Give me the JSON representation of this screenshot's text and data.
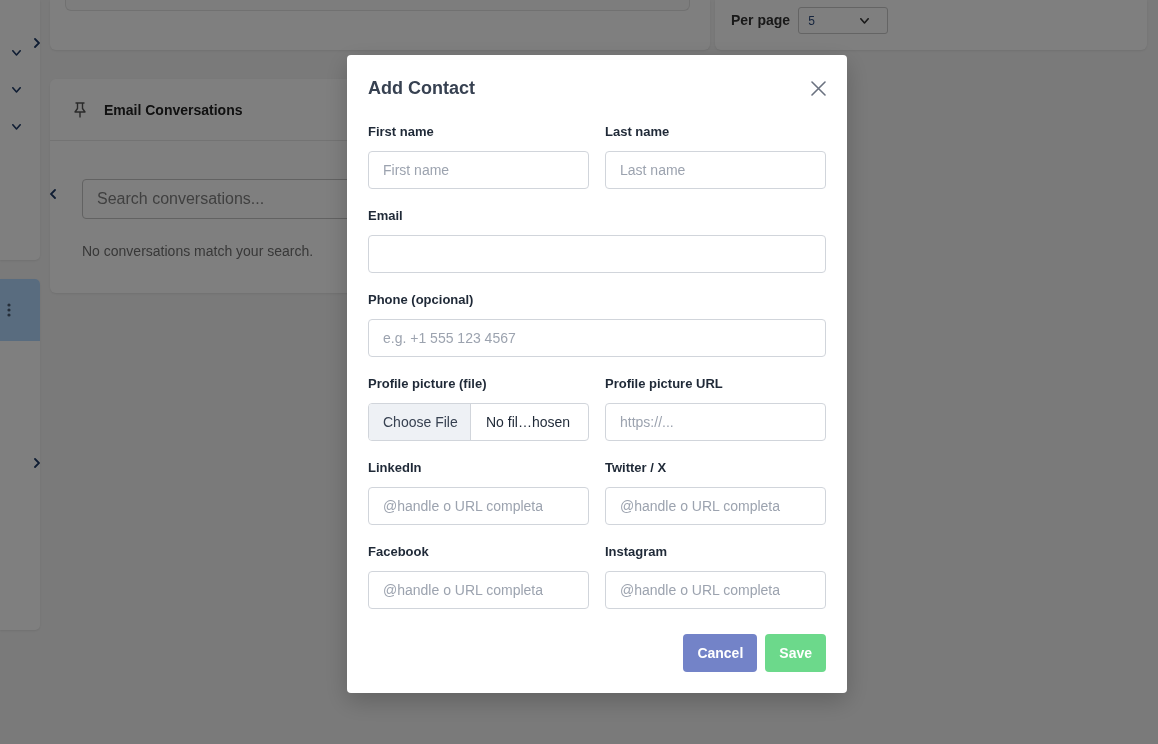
{
  "pagination": {
    "label": "Per page",
    "value": "5"
  },
  "conversations": {
    "title": "Email Conversations",
    "search": {
      "placeholder": "Search conversations..."
    },
    "empty_message": "No conversations match your search."
  },
  "dialog": {
    "title": "Add Contact",
    "rows": [
      [
        {
          "kind": "text",
          "label": "First name",
          "placeholder": "First name"
        },
        {
          "kind": "text",
          "label": "Last name",
          "placeholder": "Last name"
        }
      ],
      [
        {
          "kind": "text",
          "label": "Email"
        }
      ],
      [
        {
          "kind": "text",
          "label": "Phone (opcional)",
          "placeholder": "e.g. +1 555 123 4567"
        }
      ],
      [
        {
          "kind": "file",
          "label": "Profile picture (file)",
          "button": "Choose File",
          "status": "No fil…hosen"
        },
        {
          "kind": "text",
          "label": "Profile picture URL",
          "placeholder": "https://..."
        }
      ],
      [
        {
          "kind": "text",
          "label": "LinkedIn",
          "placeholder": "@handle o URL completa"
        },
        {
          "kind": "text",
          "label": "Twitter / X",
          "placeholder": "@handle o URL completa"
        }
      ],
      [
        {
          "kind": "text",
          "label": "Facebook",
          "placeholder": "@handle o URL completa"
        },
        {
          "kind": "text",
          "label": "Instagram",
          "placeholder": "@handle o URL completa"
        }
      ]
    ],
    "buttons": [
      {
        "kind": "cancel",
        "label": "Cancel"
      },
      {
        "kind": "save",
        "label": "Save"
      }
    ]
  }
}
